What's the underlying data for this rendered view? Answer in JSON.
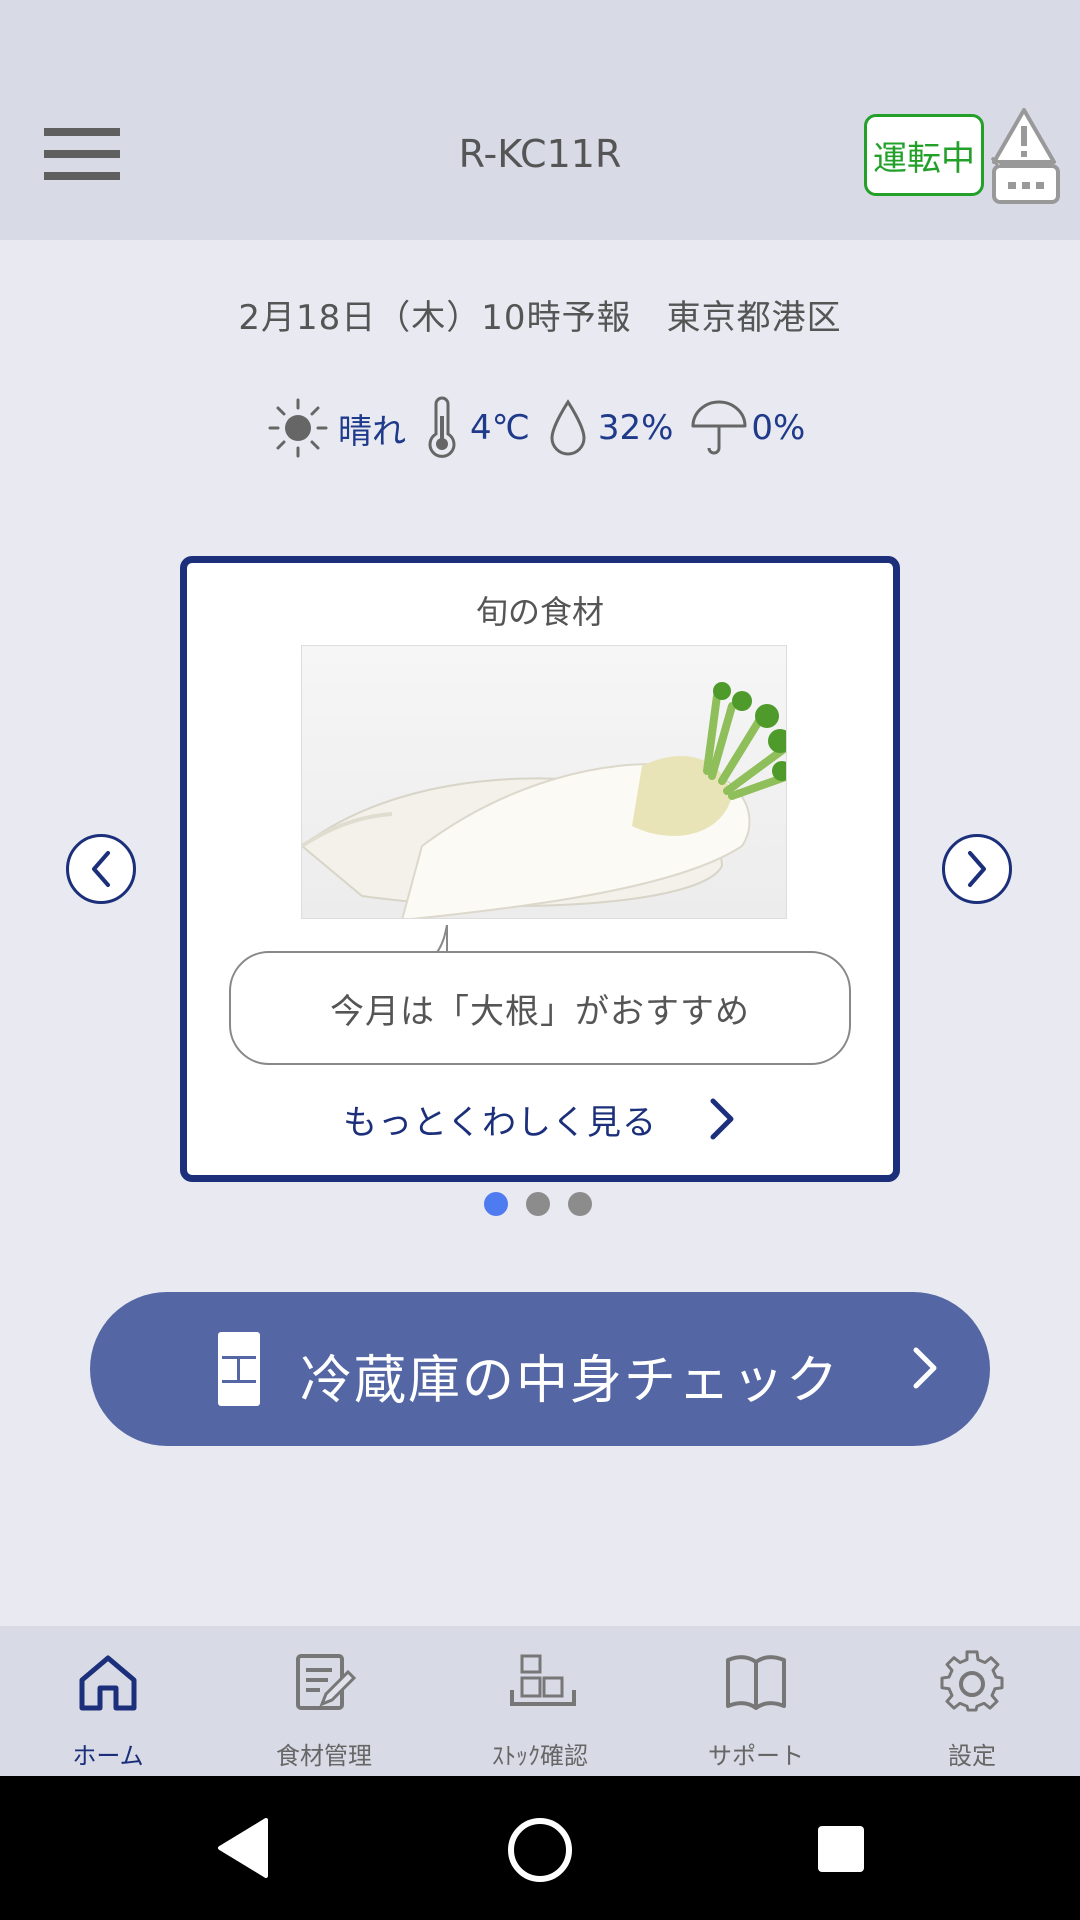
{
  "header": {
    "title": "R-KC11R",
    "status_badge": "運転中",
    "menu_icon": "hamburger-menu-icon",
    "alert_icon": "warning-message-icon"
  },
  "weather": {
    "forecast_line": "2月18日（木）10時予報　東京都港区",
    "condition": "晴れ",
    "temperature": "4℃",
    "humidity": "32%",
    "precipitation": "0%",
    "icons": [
      "sun-icon",
      "thermometer-icon",
      "droplet-icon",
      "umbrella-icon"
    ]
  },
  "carousel": {
    "title": "旬の食材",
    "image": "daikon-radish-photo",
    "bubble_text": "今月は「大根」がおすすめ",
    "more_link": "もっとくわしく見る",
    "page_count": 3,
    "active_page": 1
  },
  "fridge_check": {
    "label": "冷蔵庫の中身チェック"
  },
  "tabbar": {
    "tabs": [
      {
        "label": "ホーム",
        "icon": "home-icon",
        "active": true
      },
      {
        "label": "食材管理",
        "icon": "edit-list-icon",
        "active": false
      },
      {
        "label": "ｽﾄｯｸ確認",
        "icon": "stock-icon",
        "active": false
      },
      {
        "label": "サポート",
        "icon": "book-icon",
        "active": false
      },
      {
        "label": "設定",
        "icon": "gear-icon",
        "active": false
      }
    ]
  },
  "colors": {
    "accent_navy": "#1c2f7a",
    "button_blue": "#5466a3",
    "status_green": "#22a02a",
    "dot_active": "#4f7bf0"
  }
}
